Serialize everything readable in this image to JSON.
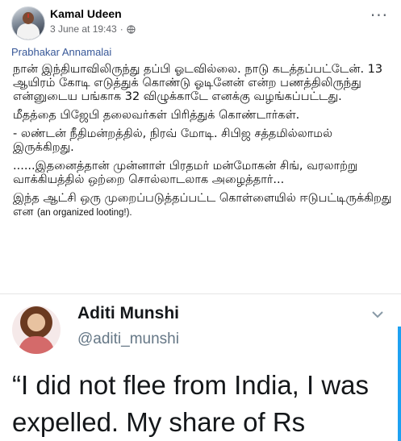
{
  "post": {
    "author": "Kamal Udeen",
    "timestamp": "3 June at 19:43",
    "separator": "·",
    "tag": "Prabhakar Annamalai",
    "paragraphs": [
      "நான் இந்தியாவிலிருந்து தப்பி ஓடவில்லை. நாடு கடத்தப்பட்டேன். 13 ஆயிரம் கோடி எடுத்துக் கொண்டு ஓடினேன் என்ற பணத்திலிருந்து என்னுடைய பங்காக 32 விழுக்காடே எனக்கு வழங்கப்பட்டது.",
      "மீதத்தை பிஜேபி தலைவர்கள் பிரித்துக் கொண்டார்கள்.",
      "- லண்டன் நீதிமன்றத்தில், நிரவ் மோடி. சிபிஜ சத்தமில்லாமல் இருக்கிறது.",
      "......இதனைத்தான் முன்னாள் பிரதமர் மன்மோகன் சிங், வரலாற்று வாக்கியத்தில் ஒற்றை சொல்லாடலாக அழைத்தார்..."
    ],
    "last_paragraph_main": "இந்த ஆட்சி ஒரு முறைப்படுத்தப்பட்ட கொள்ளையில் ஈடுபட்டிருக்கிறது என ",
    "last_paragraph_english": "(an organized looting!)."
  },
  "tweet": {
    "name": "Aditi Munshi",
    "handle": "@aditi_munshi",
    "text": "“I did not flee from India, I was expelled. My share of Rs"
  },
  "icons": {
    "privacy": "globe-icon",
    "options": "more-options-icon",
    "tweet_menu": "chevron-down-icon"
  },
  "colors": {
    "link": "#385898",
    "twitter_blue": "#1da1f2",
    "muted": "#65676b"
  }
}
